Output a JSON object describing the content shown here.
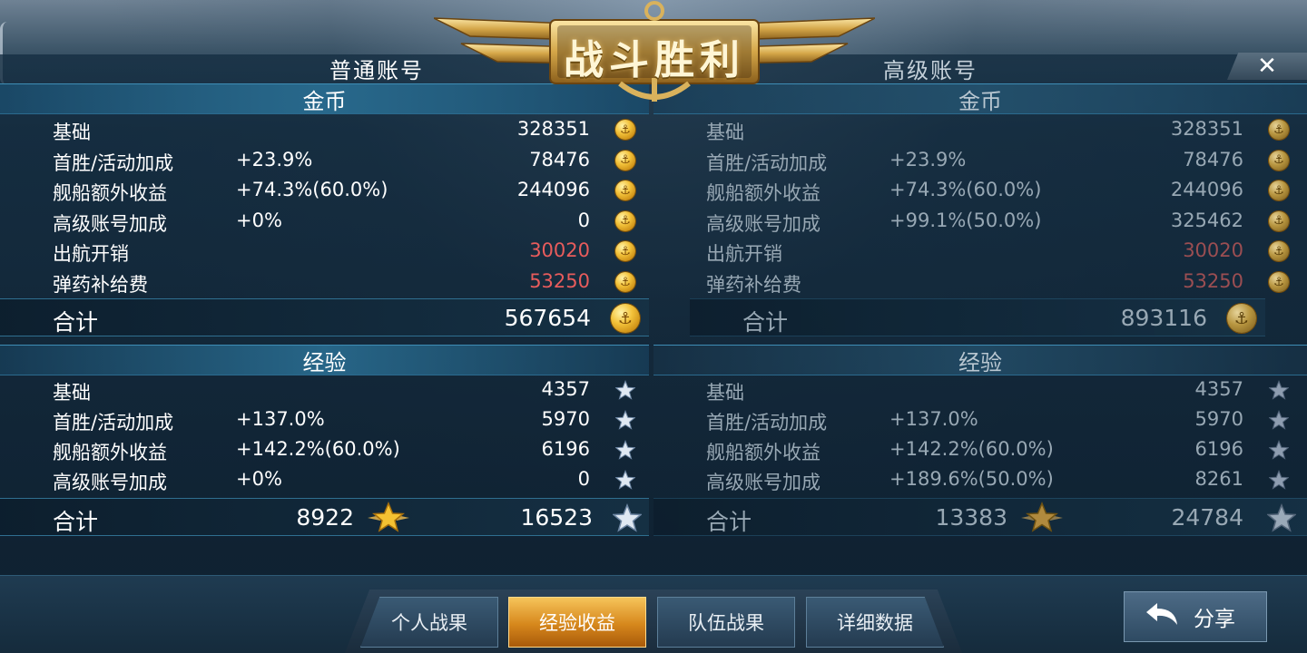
{
  "banner": {
    "title": "战斗胜利"
  },
  "close_label": "✕",
  "left": {
    "tab": "普通账号",
    "gold": {
      "header": "金币",
      "rows": [
        {
          "label": "基础",
          "pct": "",
          "value": "328351",
          "negative": false
        },
        {
          "label": "首胜/活动加成",
          "pct": "+23.9%",
          "value": "78476",
          "negative": false
        },
        {
          "label": "舰船额外收益",
          "pct": "+74.3%(60.0%)",
          "value": "244096",
          "negative": false
        },
        {
          "label": "高级账号加成",
          "pct": "+0%",
          "value": "0",
          "negative": false
        },
        {
          "label": "出航开销",
          "pct": "",
          "value": "30020",
          "negative": true
        },
        {
          "label": "弹药补给费",
          "pct": "",
          "value": "53250",
          "negative": true
        }
      ],
      "total_label": "合计",
      "total_value": "567654"
    },
    "exp": {
      "header": "经验",
      "rows": [
        {
          "label": "基础",
          "pct": "",
          "value": "4357"
        },
        {
          "label": "首胜/活动加成",
          "pct": "+137.0%",
          "value": "5970"
        },
        {
          "label": "舰船额外收益",
          "pct": "+142.2%(60.0%)",
          "value": "6196"
        },
        {
          "label": "高级账号加成",
          "pct": "+0%",
          "value": "0"
        }
      ],
      "total_label": "合计",
      "total_captain": "8922",
      "total_value": "16523"
    }
  },
  "right": {
    "tab": "高级账号",
    "gold": {
      "header": "金币",
      "rows": [
        {
          "label": "基础",
          "pct": "",
          "value": "328351",
          "negative": false
        },
        {
          "label": "首胜/活动加成",
          "pct": "+23.9%",
          "value": "78476",
          "negative": false
        },
        {
          "label": "舰船额外收益",
          "pct": "+74.3%(60.0%)",
          "value": "244096",
          "negative": false
        },
        {
          "label": "高级账号加成",
          "pct": "+99.1%(50.0%)",
          "value": "325462",
          "negative": false
        },
        {
          "label": "出航开销",
          "pct": "",
          "value": "30020",
          "negative": true
        },
        {
          "label": "弹药补给费",
          "pct": "",
          "value": "53250",
          "negative": true
        }
      ],
      "total_label": "合计",
      "total_value": "893116"
    },
    "exp": {
      "header": "经验",
      "rows": [
        {
          "label": "基础",
          "pct": "",
          "value": "4357"
        },
        {
          "label": "首胜/活动加成",
          "pct": "+137.0%",
          "value": "5970"
        },
        {
          "label": "舰船额外收益",
          "pct": "+142.2%(60.0%)",
          "value": "6196"
        },
        {
          "label": "高级账号加成",
          "pct": "+189.6%(50.0%)",
          "value": "8261"
        }
      ],
      "total_label": "合计",
      "total_captain": "13383",
      "total_value": "24784"
    }
  },
  "tabs": [
    {
      "label": "个人战果",
      "active": false
    },
    {
      "label": "经验收益",
      "active": true
    },
    {
      "label": "队伍战果",
      "active": false
    },
    {
      "label": "详细数据",
      "active": false
    }
  ],
  "share": {
    "label": "分享",
    "icon": "return-arrow-icon"
  },
  "colors": {
    "accent_gold": "#f3c23a",
    "negative": "#e85c5c",
    "panel": "#16293a"
  }
}
